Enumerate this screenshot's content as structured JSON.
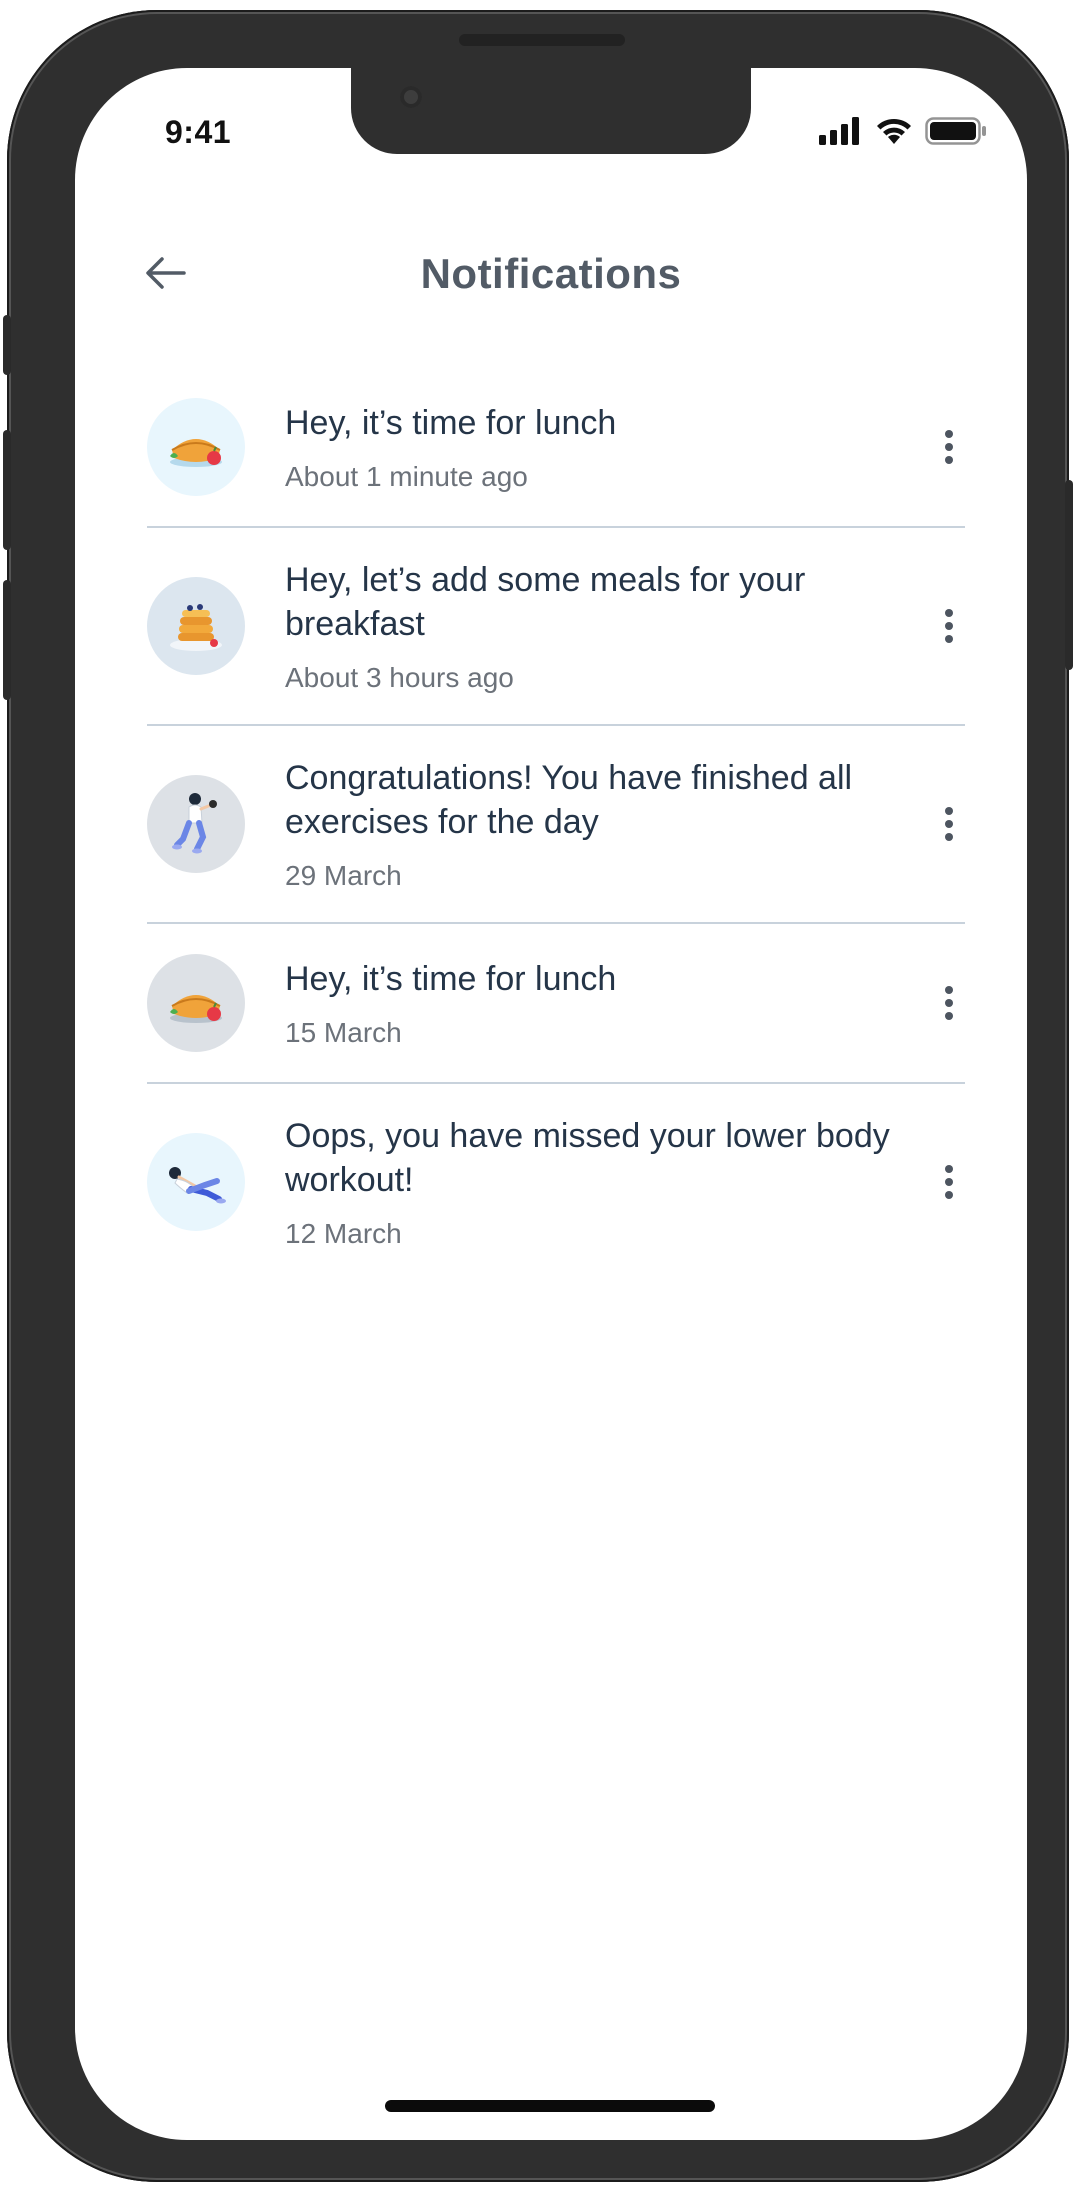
{
  "status_bar": {
    "time": "9:41"
  },
  "header": {
    "title": "Notifications",
    "back_icon": "arrow-left-icon"
  },
  "notifications": [
    {
      "icon": "pie-meal-icon",
      "title": "Hey, it’s time for lunch",
      "time": "About 1 minute ago"
    },
    {
      "icon": "pancakes-icon",
      "title": "Hey, let’s add some meals for your breakfast",
      "time": "About 3 hours ago"
    },
    {
      "icon": "woman-exercise-icon",
      "title": "Congratulations! You have finished all exercises for the day",
      "time": "29 March"
    },
    {
      "icon": "pie-meal-icon",
      "title": "Hey, it’s time for lunch",
      "time": "15 March"
    },
    {
      "icon": "workout-person-icon",
      "title": "Oops, you have missed your lower body workout!",
      "time": "12 March"
    }
  ],
  "colors": {
    "title": "#525b66",
    "item_text": "#253548",
    "time_text": "#6c727a",
    "divider": "#c8d2dc",
    "frame": "#2f2f2f"
  }
}
